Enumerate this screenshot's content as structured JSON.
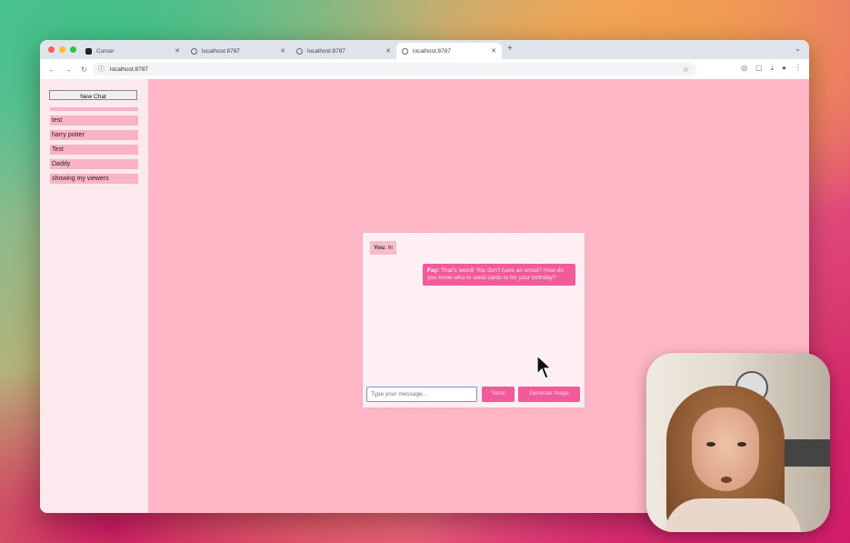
{
  "browser": {
    "tabs": [
      {
        "title": "Cursor",
        "active": false,
        "icon": "cursor-app-icon"
      },
      {
        "title": "localhost:8787",
        "active": false,
        "icon": "globe-icon"
      },
      {
        "title": "localhost:8787",
        "active": false,
        "icon": "globe-icon"
      },
      {
        "title": "localhost:8787",
        "active": true,
        "icon": "globe-icon"
      }
    ],
    "url": "localhost:8787"
  },
  "sidebar": {
    "new_chat_label": "New Chat",
    "chats": [
      "",
      "test",
      "harry potter",
      "Test",
      "Daddy",
      "showing my viewers"
    ]
  },
  "chat": {
    "messages": [
      {
        "sender": "You:",
        "text": "hi",
        "role": "user"
      },
      {
        "sender": "Fay:",
        "text": "That's weird! You don't have an email? How do you know who to send cards to for your birthday?",
        "role": "bot"
      }
    ],
    "input_placeholder": "Type your message...",
    "send_label": "Send",
    "generate_label": "Generate Image"
  },
  "colors": {
    "page_bg": "#ffb7c8",
    "sidebar_bg": "#fbe9ee",
    "chat_item": "#f8b3c5",
    "accent": "#f35a9a"
  }
}
